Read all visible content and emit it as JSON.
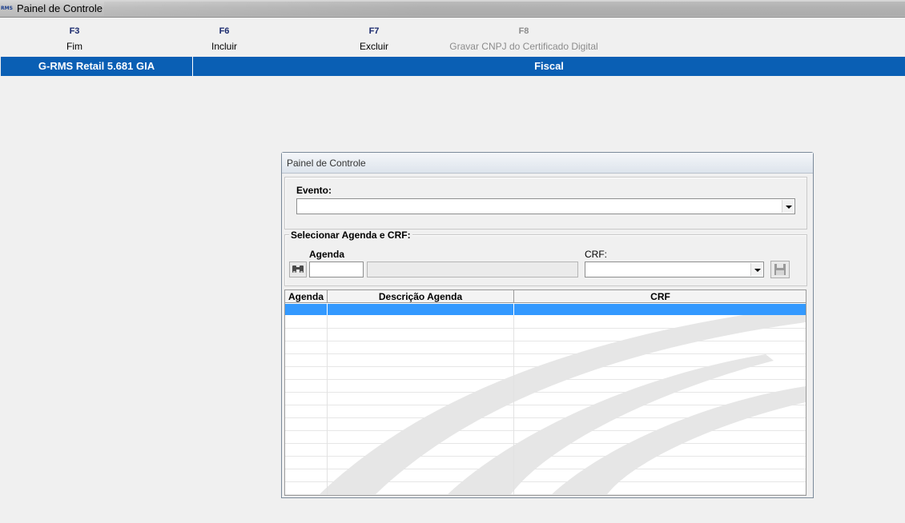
{
  "window": {
    "title": "Painel de Controle",
    "app_icon_text": "RMS"
  },
  "toolbar": {
    "keys": [
      {
        "key": "F3",
        "label": "Fim",
        "enabled": true
      },
      {
        "key": "F6",
        "label": "Incluir",
        "enabled": true
      },
      {
        "key": "F7",
        "label": "Excluir",
        "enabled": true
      },
      {
        "key": "F8",
        "label": "Gravar CNPJ do Certificado Digital",
        "enabled": false
      }
    ]
  },
  "header": {
    "product": "G-RMS Retail 5.681 GIA",
    "module": "Fiscal"
  },
  "dialog": {
    "title": "Painel de Controle",
    "evento": {
      "label": "Evento:",
      "value": ""
    },
    "selecionar": {
      "legend": "Selecionar Agenda e CRF:",
      "agenda_label": "Agenda",
      "agenda_code": "",
      "agenda_desc": "",
      "crf_label": "CRF:",
      "crf_value": ""
    },
    "grid": {
      "columns": [
        "Agenda",
        "Descrição Agenda",
        "CRF"
      ],
      "rows": []
    }
  },
  "colors": {
    "header_blue": "#0a5fb4",
    "selection_blue": "#3399ff",
    "background": "#f0f0f0"
  },
  "icons": {
    "search": "binoculars-icon",
    "save": "floppy-disk-icon",
    "dropdown": "chevron-down-icon"
  }
}
